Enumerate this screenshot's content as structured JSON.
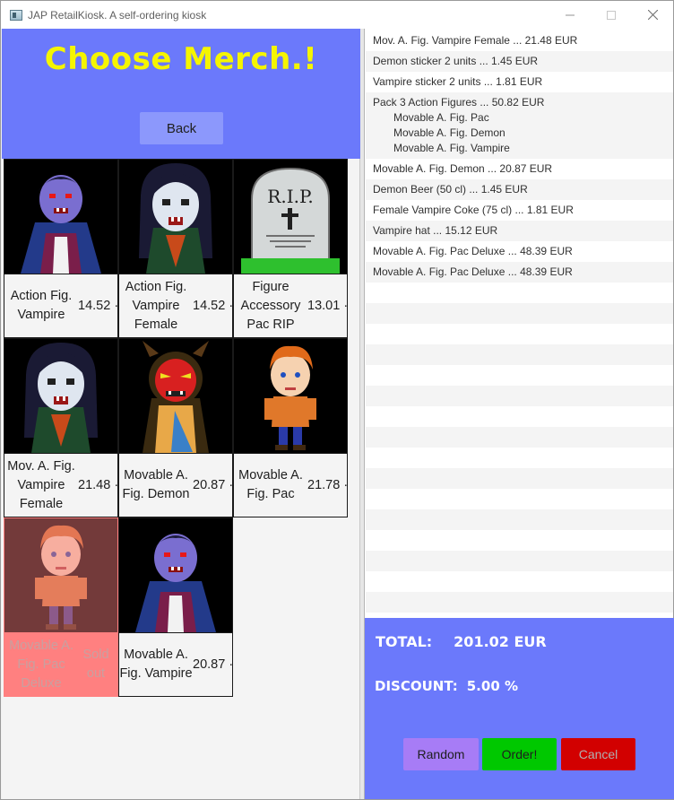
{
  "window": {
    "title": "JAP RetailKiosk. A self-ordering kiosk",
    "controls": [
      "minimize-icon",
      "maximize-icon",
      "close-icon"
    ]
  },
  "left": {
    "headline": "Choose Merch.!",
    "back_label": "Back",
    "products": [
      {
        "name": "Action Fig. Vampire",
        "price": "14.52 ·",
        "image": "vampire-portrait",
        "sold_out": false
      },
      {
        "name": "Action Fig. Vampire Female",
        "price": "14.52 ·",
        "image": "female-vampire-portrait",
        "sold_out": false
      },
      {
        "name": "Figure Accessory Pac RIP",
        "price": "13.01 ·",
        "image": "rip-tombstone",
        "sold_out": false
      },
      {
        "name": "Mov. A. Fig. Vampire Female",
        "price": "21.48 ·",
        "image": "female-vampire-portrait",
        "sold_out": false
      },
      {
        "name": "Movable A. Fig. Demon",
        "price": "20.87 ·",
        "image": "red-demon",
        "sold_out": false
      },
      {
        "name": "Movable A. Fig. Pac",
        "price": "21.78 ·",
        "image": "orange-haired-boy",
        "sold_out": false
      },
      {
        "name": "Movable A. Fig. Pac Deluxe",
        "price": "Sold out",
        "image": "orange-haired-boy",
        "sold_out": true
      },
      {
        "name": "Movable A. Fig. Vampire",
        "price": "20.87 ·",
        "image": "vampire-portrait",
        "sold_out": false
      }
    ]
  },
  "order": {
    "items": [
      {
        "text": "Mov. A. Fig. Vampire Female ... 21.48 EUR"
      },
      {
        "text": "Demon sticker 2 units ... 1.45 EUR"
      },
      {
        "text": "Vampire sticker 2 units ... 1.81 EUR"
      },
      {
        "text": "Pack 3 Action Figures ... 50.82 EUR",
        "sub": [
          "Movable A. Fig. Pac",
          "Movable A. Fig. Demon",
          "Movable A. Fig. Vampire"
        ]
      },
      {
        "text": "Movable A. Fig. Demon ... 20.87 EUR"
      },
      {
        "text": "Demon Beer (50 cl) ... 1.45 EUR"
      },
      {
        "text": "Female Vampire Coke (75 cl) ... 1.81 EUR"
      },
      {
        "text": "Vampire hat ... 15.12 EUR"
      },
      {
        "text": "Movable A. Fig. Pac Deluxe ... 48.39 EUR"
      },
      {
        "text": "Movable A. Fig. Pac Deluxe ... 48.39 EUR"
      }
    ],
    "total_label": "TOTAL:",
    "total_value": "201.02 EUR",
    "discount_label": "DISCOUNT:",
    "discount_value": "5.00 %",
    "random_label": "Random",
    "order_label": "Order!",
    "cancel_label": "Cancel"
  },
  "colors": {
    "panel_blue": "#6b79fb",
    "headline_yellow": "#f5f500",
    "order_green": "#00c800",
    "cancel_red": "#d20000",
    "random_purple": "#a77cf6",
    "soldout_pink": "#ff8080"
  }
}
